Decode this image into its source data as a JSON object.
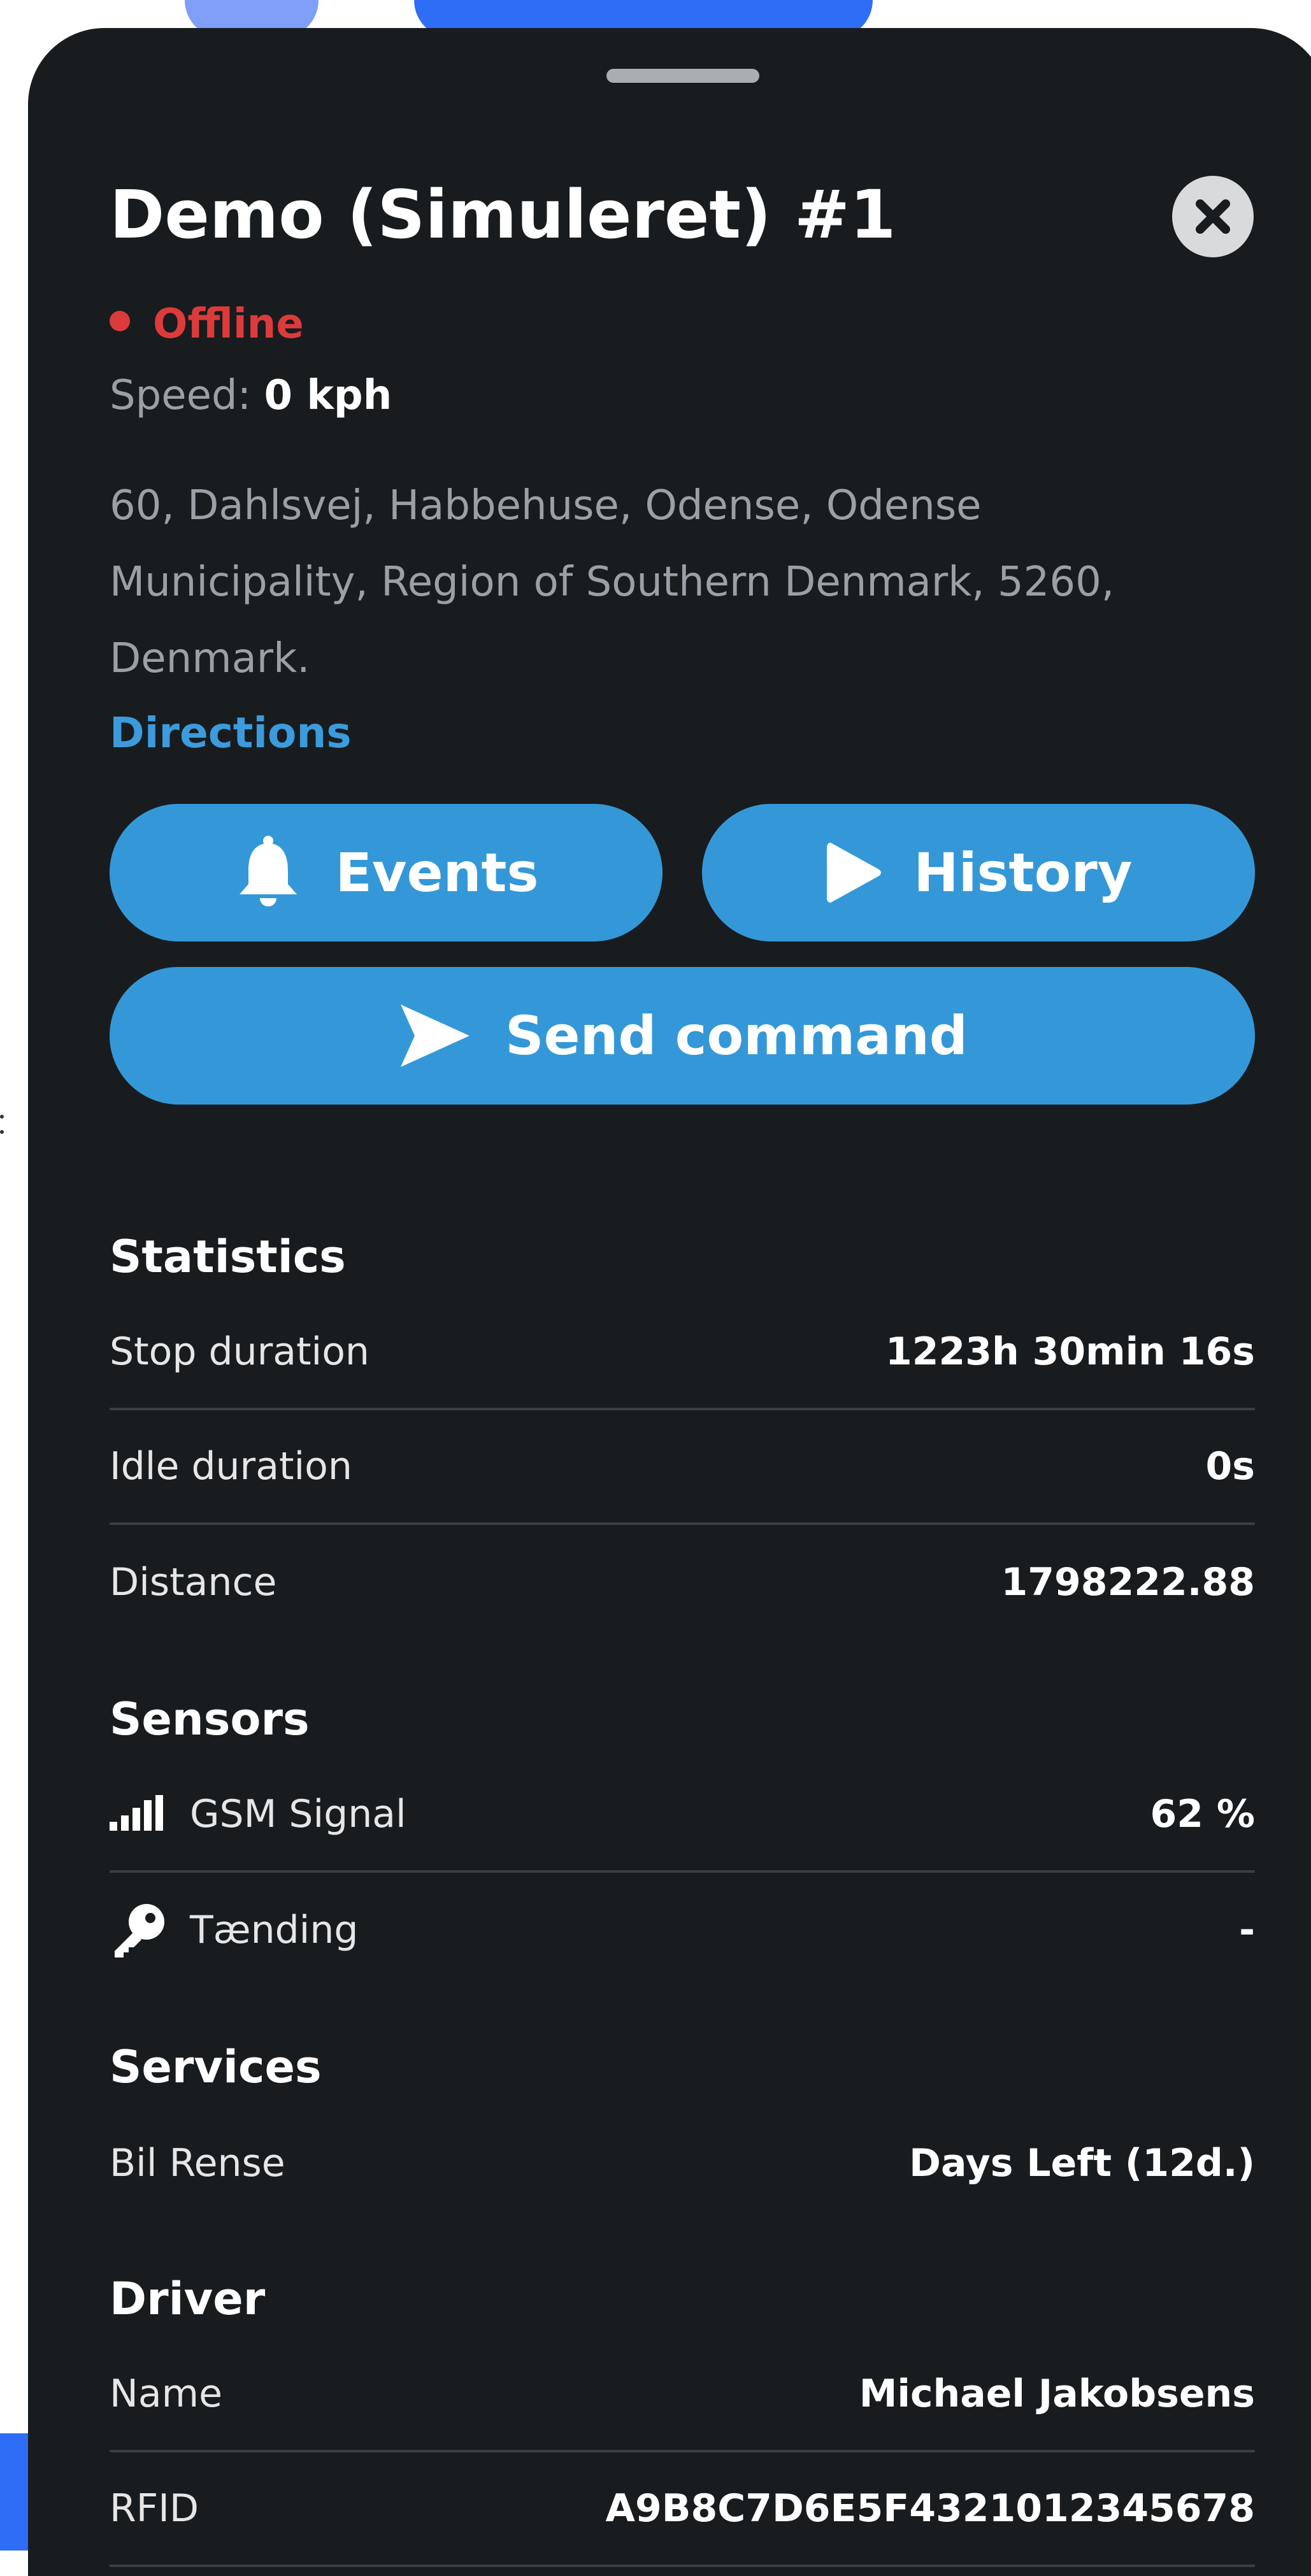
{
  "device": {
    "title": "Demo (Simuleret) #1",
    "status": "Offline",
    "status_color": "#dd3b3b",
    "speed_label": "Speed:",
    "speed_value": "0 kph",
    "address": "60, Dahlsvej, Habbehuse, Odense, Odense Municipality, Region of Southern Denmark, 5260, Denmark.",
    "directions": "Directions"
  },
  "actions": {
    "events": "Events",
    "history": "History",
    "send_command": "Send command",
    "accent": "#3498d8"
  },
  "statistics": {
    "title": "Statistics",
    "rows": [
      {
        "label": "Stop duration",
        "value": "1223h 30min 16s"
      },
      {
        "label": "Idle duration",
        "value": "0s"
      },
      {
        "label": "Distance",
        "value": "1798222.88"
      }
    ]
  },
  "sensors": {
    "title": "Sensors",
    "rows": [
      {
        "icon": "signal-bars-icon",
        "label": "GSM Signal",
        "value": "62 %"
      },
      {
        "icon": "key-icon",
        "label": "Tænding",
        "value": "-"
      }
    ]
  },
  "services": {
    "title": "Services",
    "rows": [
      {
        "label": "Bil Rense",
        "value": "Days Left (12d.)"
      }
    ]
  },
  "driver": {
    "title": "Driver",
    "rows": [
      {
        "label": "Name",
        "value": "Michael Jakobsens"
      },
      {
        "label": "RFID",
        "value": "A9B8C7D6E5F4321012345678"
      }
    ]
  }
}
